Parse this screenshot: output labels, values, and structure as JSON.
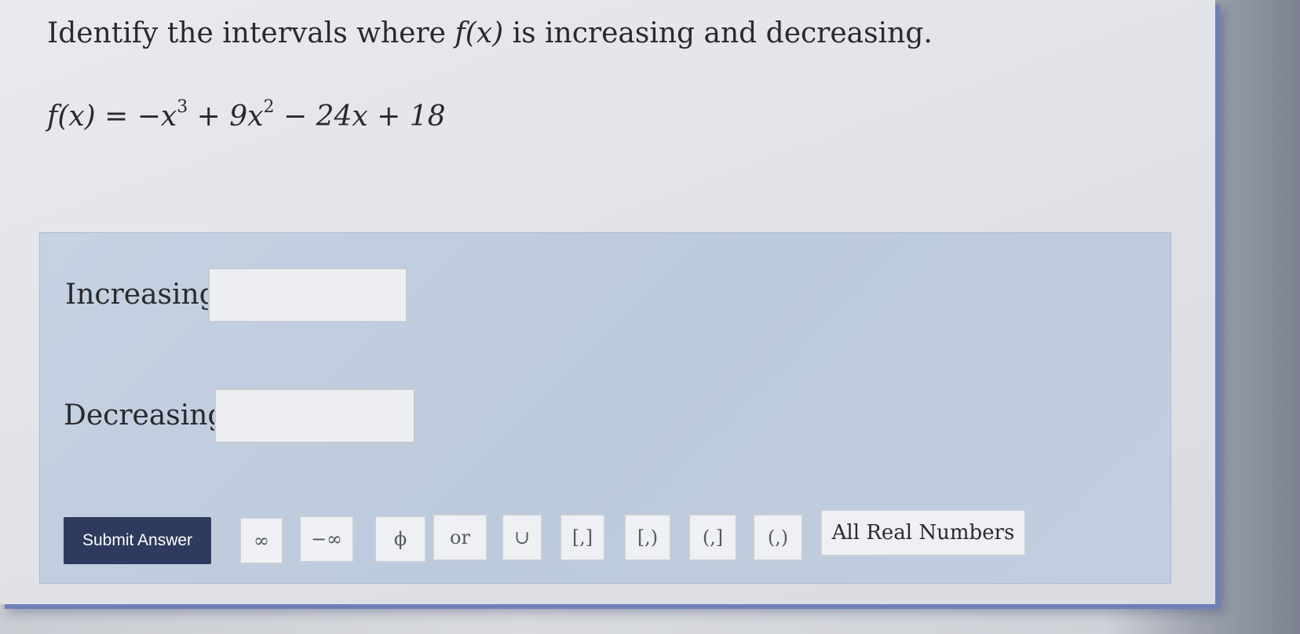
{
  "question": {
    "title_prefix": "Identify the intervals where ",
    "title_func": "f(x)",
    "title_suffix": " is increasing and decreasing.",
    "function_lhs": "f(x) = −x",
    "exp_cubed": "3",
    "term_mid": " + 9x",
    "exp_squared": "2",
    "term_rest": " − 24x + 18"
  },
  "answer_panel": {
    "increasing_label": "Increasing:",
    "increasing_value": "",
    "decreasing_label": "Decreasing:",
    "decreasing_value": "",
    "submit_label": "Submit Answer"
  },
  "toolbar": {
    "infinity": "∞",
    "neg_infinity": "−∞",
    "empty_set": "ϕ",
    "or": "or",
    "union": "∪",
    "closed_closed": "[,]",
    "closed_open": "[,)",
    "open_closed": "(,]",
    "open_open": "(,)",
    "all_real": "All Real Numbers"
  }
}
